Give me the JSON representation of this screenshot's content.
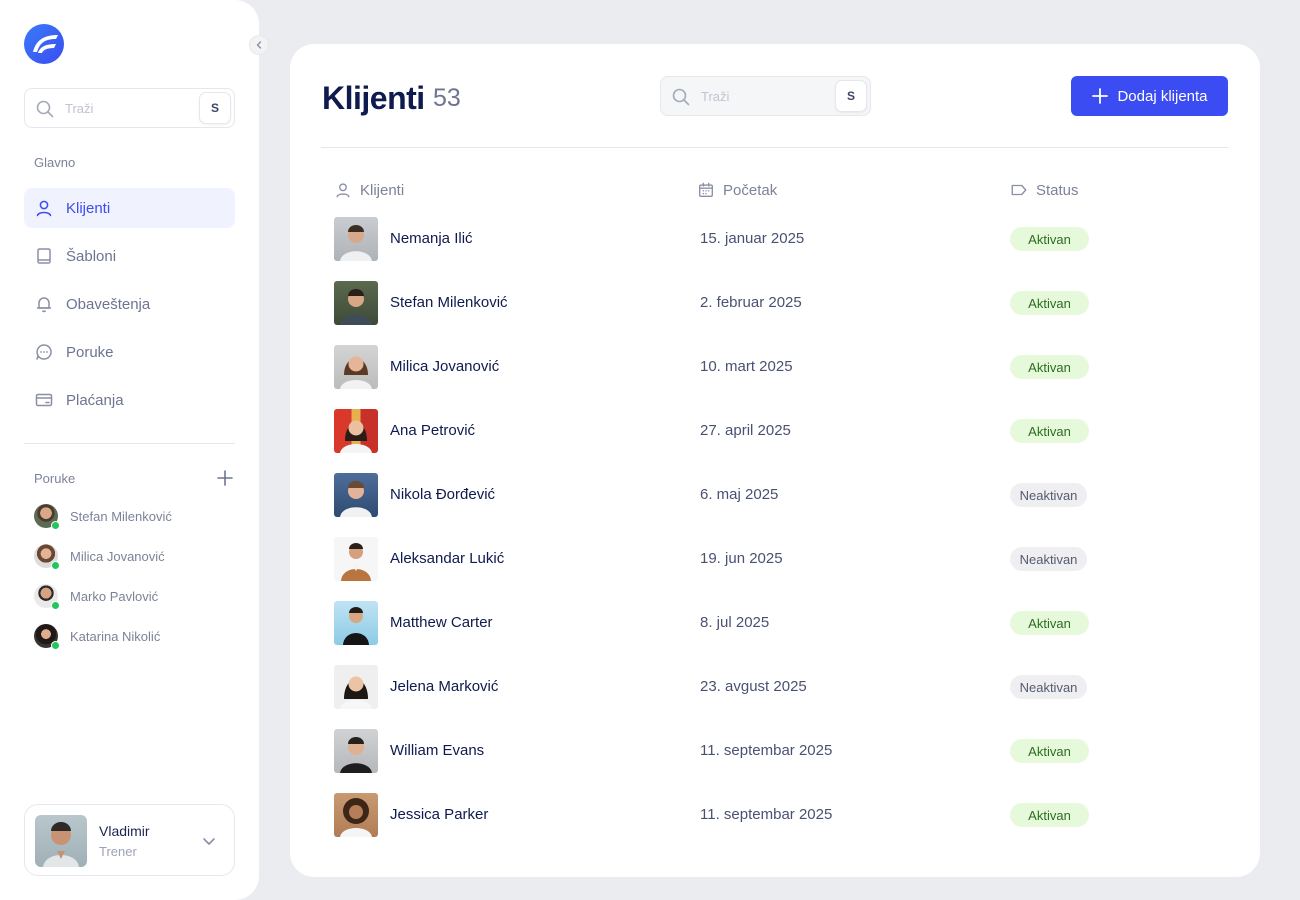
{
  "sidebar": {
    "search": {
      "placeholder": "Traži",
      "shortcut": "S"
    },
    "main_section_label": "Glavno",
    "nav": [
      {
        "label": "Klijenti",
        "icon": "user-icon",
        "active": true
      },
      {
        "label": "Šabloni",
        "icon": "book-icon",
        "active": false
      },
      {
        "label": "Obaveštenja",
        "icon": "bell-icon",
        "active": false
      },
      {
        "label": "Poruke",
        "icon": "chat-icon",
        "active": false
      },
      {
        "label": "Plaćanja",
        "icon": "credit-card-icon",
        "active": false
      }
    ],
    "messages_section_label": "Poruke",
    "chats": [
      {
        "name": "Stefan Milenković",
        "online": true
      },
      {
        "name": "Milica Jovanović",
        "online": true
      },
      {
        "name": "Marko Pavlović",
        "online": true
      },
      {
        "name": "Katarina Nikolić",
        "online": true
      }
    ],
    "profile": {
      "name": "Vladimir",
      "role": "Trener"
    }
  },
  "main": {
    "title": "Klijenti",
    "count": "53",
    "search": {
      "placeholder": "Traži",
      "shortcut": "S"
    },
    "add_button_label": "Dodaj klijenta",
    "columns": [
      {
        "label": "Klijenti",
        "icon": "user-icon"
      },
      {
        "label": "Početak",
        "icon": "calendar-icon"
      },
      {
        "label": "Status",
        "icon": "tag-icon"
      }
    ],
    "rows": [
      {
        "name": "Nemanja Ilić",
        "start": "15. januar 2025",
        "status": "Aktivan",
        "active": true
      },
      {
        "name": "Stefan Milenković",
        "start": "2. februar 2025",
        "status": "Aktivan",
        "active": true
      },
      {
        "name": "Milica Jovanović",
        "start": "10. mart 2025",
        "status": "Aktivan",
        "active": true
      },
      {
        "name": "Ana Petrović",
        "start": "27. april 2025",
        "status": "Aktivan",
        "active": true
      },
      {
        "name": "Nikola Đorđević",
        "start": "6. maj 2025",
        "status": "Neaktivan",
        "active": false
      },
      {
        "name": "Aleksandar Lukić",
        "start": "19. jun 2025",
        "status": "Neaktivan",
        "active": false
      },
      {
        "name": "Matthew Carter",
        "start": "8. jul 2025",
        "status": "Aktivan",
        "active": true
      },
      {
        "name": "Jelena Marković",
        "start": "23. avgust 2025",
        "status": "Neaktivan",
        "active": false
      },
      {
        "name": "William Evans",
        "start": "11. septembar 2025",
        "status": "Aktivan",
        "active": true
      },
      {
        "name": "Jessica Parker",
        "start": "11. septembar 2025",
        "status": "Aktivan",
        "active": true
      }
    ]
  },
  "colors": {
    "accent": "#3a4cf2",
    "active_badge_bg": "#e6f9db",
    "active_badge_text": "#2c6e1d",
    "inactive_badge_bg": "#efeff1",
    "online": "#22c55e"
  }
}
